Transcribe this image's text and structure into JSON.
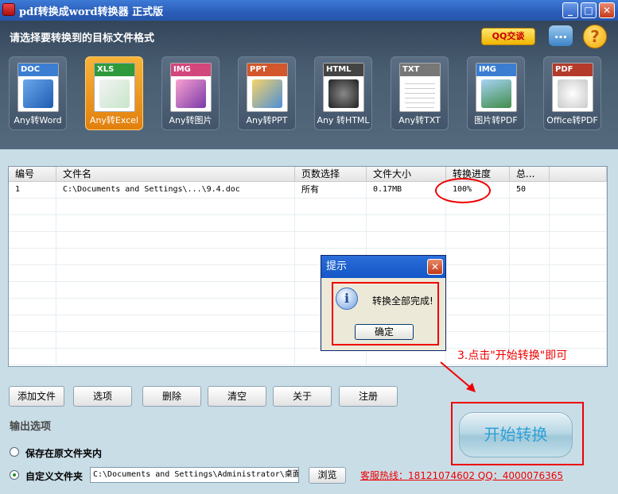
{
  "window": {
    "title": "pdf转换成word转换器 正式版",
    "minimize": "_",
    "maximize": "□",
    "close": "✕"
  },
  "header": {
    "prompt": "请选择要转换到的目标文件格式",
    "qq_button": "QQ交谈",
    "chat_icon": "…",
    "help_icon": "?"
  },
  "formats": [
    {
      "tag": "DOC",
      "label": "Any转Word",
      "color": "#3b7ed1",
      "selected": false
    },
    {
      "tag": "XLS",
      "label": "Any转Excel",
      "color": "#2f9a3c",
      "selected": true
    },
    {
      "tag": "IMG",
      "label": "Any转图片",
      "color": "#d2477c",
      "selected": false
    },
    {
      "tag": "PPT",
      "label": "Any转PPT",
      "color": "#d2572d",
      "selected": false
    },
    {
      "tag": "HTML",
      "label": "Any 转HTML",
      "color": "#444444",
      "selected": false
    },
    {
      "tag": "TXT",
      "label": "Any转TXT",
      "color": "#777777",
      "selected": false
    },
    {
      "tag": "IMG",
      "label": "图片转PDF",
      "color": "#3b7ed1",
      "selected": false
    },
    {
      "tag": "PDF",
      "label": "Office转PDF",
      "color": "#b43a2b",
      "selected": false
    }
  ],
  "table": {
    "columns": [
      "编号",
      "文件名",
      "页数选择",
      "文件大小",
      "转换进度",
      "总...",
      ""
    ],
    "rows": [
      [
        "1",
        "C:\\Documents and Settings\\...\\9.4.doc",
        "所有",
        "0.17MB",
        "100%",
        "50",
        ""
      ]
    ]
  },
  "dialog": {
    "title": "提示",
    "message": "转换全部完成!",
    "ok": "确定",
    "info_icon": "i"
  },
  "annotation": "3.点击\"开始转换\"即可",
  "buttons": {
    "add_file": "添加文件",
    "options": "选项",
    "delete": "删除",
    "clear": "清空",
    "about": "关于",
    "register": "注册",
    "browse": "浏览",
    "start": "开始转换"
  },
  "output": {
    "section_label": "输出选项",
    "option_original": "保存在原文件夹内",
    "option_custom": "自定义文件夹",
    "selected": "custom",
    "path": "C:\\Documents and Settings\\Administrator\\桌面"
  },
  "hotline": "客服热线：18121074602 QQ：4000076365"
}
